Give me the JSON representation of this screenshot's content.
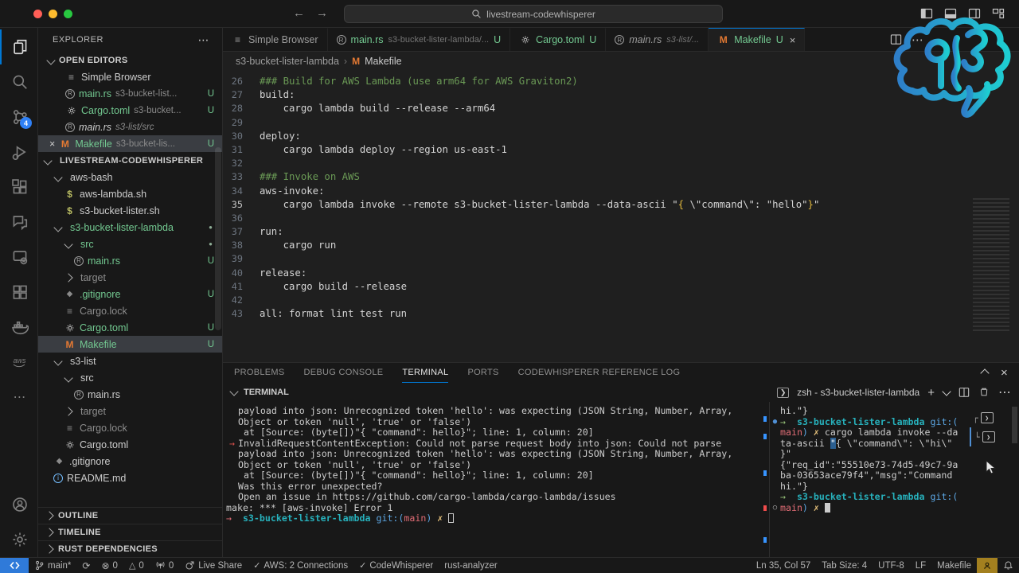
{
  "colors": {
    "accent": "#0078d4",
    "git_green": "#73c991",
    "makefile_orange": "#e37933",
    "remote_blue": "#2f7ad9",
    "error_red": "#e06c75",
    "terminal_cyan": "#27b1bc",
    "brace_gold": "#e2b93d",
    "badge_gold": "#a3801f"
  },
  "window": {
    "search": "livestream-codewhisperer",
    "nav_back": "←",
    "nav_forward": "→",
    "titlebar_icons": [
      "toggle-sidebar",
      "toggle-panel",
      "toggle-secondary-sidebar",
      "customize-layout"
    ]
  },
  "activity_bar": {
    "top": [
      {
        "icon": "files",
        "active": true
      },
      {
        "icon": "search",
        "active": false
      },
      {
        "icon": "source-control",
        "active": false,
        "badge": "4"
      },
      {
        "icon": "run-debug",
        "active": false
      },
      {
        "icon": "extensions",
        "active": false
      },
      {
        "icon": "chat",
        "active": false
      },
      {
        "icon": "remote-explorer",
        "active": false
      },
      {
        "icon": "window-grid",
        "active": false
      },
      {
        "icon": "docker",
        "active": false
      },
      {
        "icon": "aws",
        "active": false
      },
      {
        "icon": "more",
        "active": false
      }
    ],
    "bottom": [
      {
        "icon": "account"
      },
      {
        "icon": "settings-gear"
      }
    ]
  },
  "explorer": {
    "title": "EXPLORER",
    "more": "⋯",
    "open_editors_label": "OPEN EDITORS",
    "open_editors": [
      {
        "icon": "list",
        "label": "Simple Browser"
      },
      {
        "icon": "rust",
        "label": "main.rs",
        "desc": "s3-bucket-list...",
        "u": "U",
        "green": true
      },
      {
        "icon": "gear-file",
        "label": "Cargo.toml",
        "desc": "s3-bucket...",
        "u": "U",
        "green": true
      },
      {
        "icon": "rust",
        "label": "main.rs",
        "desc": "s3-list/src",
        "italic": true
      },
      {
        "icon": "make",
        "label": "Makefile",
        "desc": "s3-bucket-lis...",
        "u": "U",
        "green": true,
        "selected": true,
        "close": true
      }
    ],
    "tree": [
      {
        "d": 0,
        "chev": "down",
        "label": "LIVESTREAM-CODEWHISPERER",
        "bold": true
      },
      {
        "d": 1,
        "chev": "down",
        "label": "aws-bash"
      },
      {
        "d": 2,
        "icon": "shell",
        "label": "aws-lambda.sh"
      },
      {
        "d": 2,
        "icon": "shell",
        "label": "s3-bucket-lister.sh"
      },
      {
        "d": 1,
        "chev": "down",
        "label": "s3-bucket-lister-lambda",
        "green": true,
        "dot": true
      },
      {
        "d": 2,
        "chev": "down",
        "label": "src",
        "green": true,
        "dot": true
      },
      {
        "d": 3,
        "icon": "rust",
        "label": "main.rs",
        "green": true,
        "u": "U"
      },
      {
        "d": 2,
        "chev": "right",
        "label": "target",
        "dim": true
      },
      {
        "d": 2,
        "icon": "diamond",
        "label": ".gitignore",
        "green": true,
        "u": "U"
      },
      {
        "d": 2,
        "icon": "lock",
        "label": "Cargo.lock",
        "dim": true
      },
      {
        "d": 2,
        "icon": "gear-file",
        "label": "Cargo.toml",
        "green": true,
        "u": "U"
      },
      {
        "d": 2,
        "icon": "make",
        "label": "Makefile",
        "green": true,
        "u": "U",
        "selected": true
      },
      {
        "d": 1,
        "chev": "down",
        "label": "s3-list"
      },
      {
        "d": 2,
        "chev": "down",
        "label": "src"
      },
      {
        "d": 3,
        "icon": "rust",
        "label": "main.rs"
      },
      {
        "d": 2,
        "chev": "right",
        "label": "target",
        "dim": true
      },
      {
        "d": 2,
        "icon": "lock",
        "label": "Cargo.lock",
        "dim": true
      },
      {
        "d": 2,
        "icon": "gear-file",
        "label": "Cargo.toml"
      },
      {
        "d": 1,
        "icon": "diamond",
        "label": ".gitignore"
      },
      {
        "d": 1,
        "icon": "info",
        "label": "README.md"
      }
    ],
    "sections": [
      "OUTLINE",
      "TIMELINE",
      "RUST DEPENDENCIES"
    ]
  },
  "tabs": [
    {
      "icon": "list",
      "label": "Simple Browser"
    },
    {
      "icon": "rust",
      "label": "main.rs",
      "desc": "s3-bucket-lister-lambda/...",
      "u": "U",
      "green": true
    },
    {
      "icon": "gear-file",
      "label": "Cargo.toml",
      "u": "U",
      "green": true
    },
    {
      "icon": "rust",
      "label": "main.rs",
      "desc": "s3-list/...",
      "italic": true
    },
    {
      "icon": "make",
      "label": "Makefile",
      "u": "U",
      "green": true,
      "active": true,
      "close": true
    }
  ],
  "tab_actions": [
    "split-editor",
    "more"
  ],
  "breadcrumb": {
    "items": [
      "s3-bucket-lister-lambda",
      "Makefile"
    ],
    "sep": "›"
  },
  "editor": {
    "lines": [
      {
        "n": 26,
        "c": "cm",
        "t": "### Build for AWS Lambda (use arm64 for AWS Graviton2)"
      },
      {
        "n": 27,
        "t": "build:"
      },
      {
        "n": 28,
        "t": "    cargo lambda build --release --arm64"
      },
      {
        "n": 29,
        "t": ""
      },
      {
        "n": 30,
        "t": "deploy:"
      },
      {
        "n": 31,
        "t": "    cargo lambda deploy --region us-east-1"
      },
      {
        "n": 32,
        "t": ""
      },
      {
        "n": 33,
        "c": "cm",
        "t": "### Invoke on AWS"
      },
      {
        "n": 34,
        "t": "aws-invoke:"
      },
      {
        "n": 35,
        "active": true,
        "segs": [
          {
            "t": "    cargo lambda invoke --remote s3-bucket-lister-lambda --data-ascii \""
          },
          {
            "t": "{",
            "c": "gold"
          },
          {
            "t": " \\\"command\\\": \"hello\""
          },
          {
            "t": "}",
            "c": "gold"
          },
          {
            "t": "\""
          }
        ]
      },
      {
        "n": 36,
        "t": ""
      },
      {
        "n": 37,
        "t": "run:"
      },
      {
        "n": 38,
        "t": "    cargo run"
      },
      {
        "n": 39,
        "t": ""
      },
      {
        "n": 40,
        "t": "release:"
      },
      {
        "n": 41,
        "t": "    cargo build --release"
      },
      {
        "n": 42,
        "t": ""
      },
      {
        "n": 43,
        "t": "all: format lint test run"
      }
    ]
  },
  "panel": {
    "tabs": [
      {
        "label": "PROBLEMS"
      },
      {
        "label": "DEBUG CONSOLE"
      },
      {
        "label": "TERMINAL",
        "active": true
      },
      {
        "label": "PORTS"
      },
      {
        "label": "CODEWHISPERER REFERENCE LOG"
      }
    ],
    "terminal_label": "TERMINAL",
    "terminal_session": "zsh - s3-bucket-lister-lambda",
    "header_icons": [
      "new-terminal",
      "launch-profile-chevron",
      "split-terminal",
      "kill-terminal",
      "more"
    ],
    "corner_icons": [
      "maximize-panel",
      "close-panel"
    ],
    "left_lines": [
      {
        "t": "payload into json: Unrecognized token 'hello': was expecting (JSON String, Number, Array,"
      },
      {
        "t": "Object or token 'null', 'true' or 'false')"
      },
      {
        "t": " at [Source: (byte[])\"{ \"command\": hello}\"; line: 1, column: 20]"
      },
      {
        "deco": "arrow",
        "t": "InvalidRequestContentException: Could not parse request body into json: Could not parse"
      },
      {
        "t": "payload into json: Unrecognized token 'hello': was expecting (JSON String, Number, Array,"
      },
      {
        "t": "Object or token 'null', 'true' or 'false')"
      },
      {
        "t": " at [Source: (byte[])\"{ \"command\": hello}\"; line: 1, column: 20]"
      },
      {
        "t": ""
      },
      {
        "t": "Was this error unexpected?"
      },
      {
        "t": "Open an issue in https://github.com/cargo-lambda/cargo-lambda/issues"
      },
      {
        "t": ""
      },
      {
        "outdent": true,
        "t": "make: *** [aws-invoke] Error 1"
      },
      {
        "outdent": true,
        "segs": [
          {
            "t": "→",
            "c": "red"
          },
          {
            "t": "  "
          },
          {
            "t": "s3-bucket-lister-lambda",
            "c": "cyan"
          },
          {
            "t": " "
          },
          {
            "t": "git:(",
            "c": "blue"
          },
          {
            "t": "main",
            "c": "red"
          },
          {
            "t": ") ",
            "c": "blue"
          },
          {
            "t": "✗",
            "c": "yel"
          },
          {
            "t": " "
          }
        ],
        "cursor": "outline"
      }
    ],
    "right_lines": [
      {
        "t": "hi.\"}"
      },
      {
        "deco": "dot",
        "segs": [
          {
            "t": "→",
            "c": "grn"
          },
          {
            "t": "  "
          },
          {
            "t": "s3-bucket-lister-lambda",
            "c": "cyan"
          },
          {
            "t": " "
          },
          {
            "t": "git:(",
            "c": "blue"
          }
        ]
      },
      {
        "segs": [
          {
            "t": "main",
            "c": "red"
          },
          {
            "t": ") ",
            "c": "blue"
          },
          {
            "t": "✗",
            "c": "yel"
          },
          {
            "t": " cargo lambda invoke --da"
          }
        ]
      },
      {
        "segs": [
          {
            "t": "ta-ascii "
          },
          {
            "t": "\"",
            "c": "sel"
          },
          {
            "t": "{ \\\"command\\\": \\\"hi\\\""
          }
        ]
      },
      {
        "t": "}\""
      },
      {
        "t": "{\"req_id\":\"55510e73-74d5-49c7-9a"
      },
      {
        "t": "ba-03653ace79f4\",\"msg\":\"Command"
      },
      {
        "t": "hi.\"}"
      },
      {
        "segs": [
          {
            "t": "→",
            "c": "grn"
          },
          {
            "t": "  "
          },
          {
            "t": "s3-bucket-lister-lambda",
            "c": "cyan"
          },
          {
            "t": " "
          },
          {
            "t": "git:(",
            "c": "blue"
          }
        ]
      },
      {
        "deco": "circle",
        "segs": [
          {
            "t": "main",
            "c": "red"
          },
          {
            "t": ") ",
            "c": "blue"
          },
          {
            "t": "✗",
            "c": "yel"
          },
          {
            "t": " "
          }
        ],
        "cursor": "block"
      }
    ],
    "sessions_list": [
      {
        "prefix": "┌",
        "icon": "terminal-session"
      },
      {
        "prefix": "└",
        "icon": "terminal-session",
        "selected": true
      }
    ]
  },
  "status_bar": {
    "left": [
      {
        "icon": "remote",
        "button": true,
        "name": "remote-window"
      },
      {
        "icon": "branch",
        "label": "main*"
      },
      {
        "icon": "sync",
        "label": ""
      },
      {
        "icon": "error",
        "label": "0"
      },
      {
        "icon": "warning",
        "label": "0"
      },
      {
        "icon": "tower",
        "label": "0"
      },
      {
        "icon": "share",
        "label": "Live Share"
      },
      {
        "icon": "check",
        "label": "AWS: 2 Connections"
      },
      {
        "icon": "check",
        "label": "CodeWhisperer"
      },
      {
        "icon": "",
        "label": "rust-analyzer"
      }
    ],
    "right": [
      {
        "icon": "",
        "label": "Ln 35, Col 57"
      },
      {
        "icon": "",
        "label": "Tab Size: 4"
      },
      {
        "icon": "",
        "label": "UTF-8"
      },
      {
        "icon": "",
        "label": "LF"
      },
      {
        "icon": "",
        "label": "Makefile"
      },
      {
        "icon": "cw-gold",
        "label": "",
        "badge": true
      },
      {
        "icon": "bell",
        "label": ""
      }
    ]
  }
}
